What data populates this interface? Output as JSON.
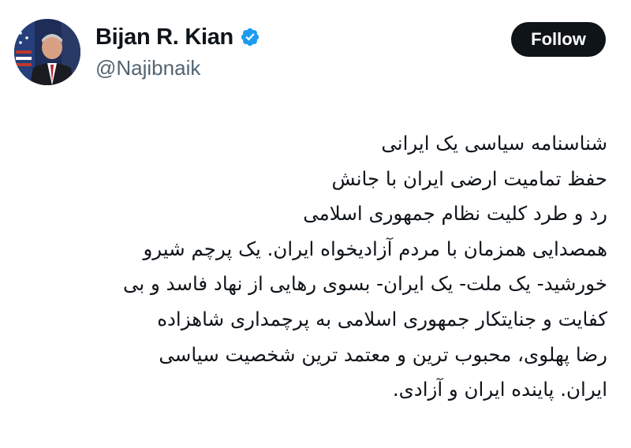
{
  "author": {
    "display_name": "Bijan R. Kian",
    "handle": "@Najibnaik",
    "verified_icon": "verified-badge-icon",
    "verified_color": "#1d9bf0",
    "avatar_icon": "profile-photo-avatar"
  },
  "actions": {
    "follow_label": "Follow"
  },
  "tweet": {
    "lines": [
      "شناسنامه سیاسی یک ایرانی",
      "حفظ تمامیت ارضی ایران با جانش",
      "رد و طرد کلیت نظام جمهوری اسلامی",
      "همصدایی همزمان با مردم آزادیخواه ایران. یک پرچم شیرو",
      "خورشید- یک ملت- یک ایران- بسوی رهایی از نهاد فاسد و بی",
      "کفایت و جنایتکار جمهوری اسلامی به پرچمداری شاهزاده",
      "رضا پهلوی، محبوب ترین و معتمد ترین شخصیت سیاسی",
      "ایران. پاینده ایران و آزادی."
    ]
  },
  "colors": {
    "text_primary": "#0f1419",
    "text_secondary": "#536471",
    "button_bg": "#0f1419",
    "button_text": "#ffffff",
    "background": "#ffffff"
  }
}
